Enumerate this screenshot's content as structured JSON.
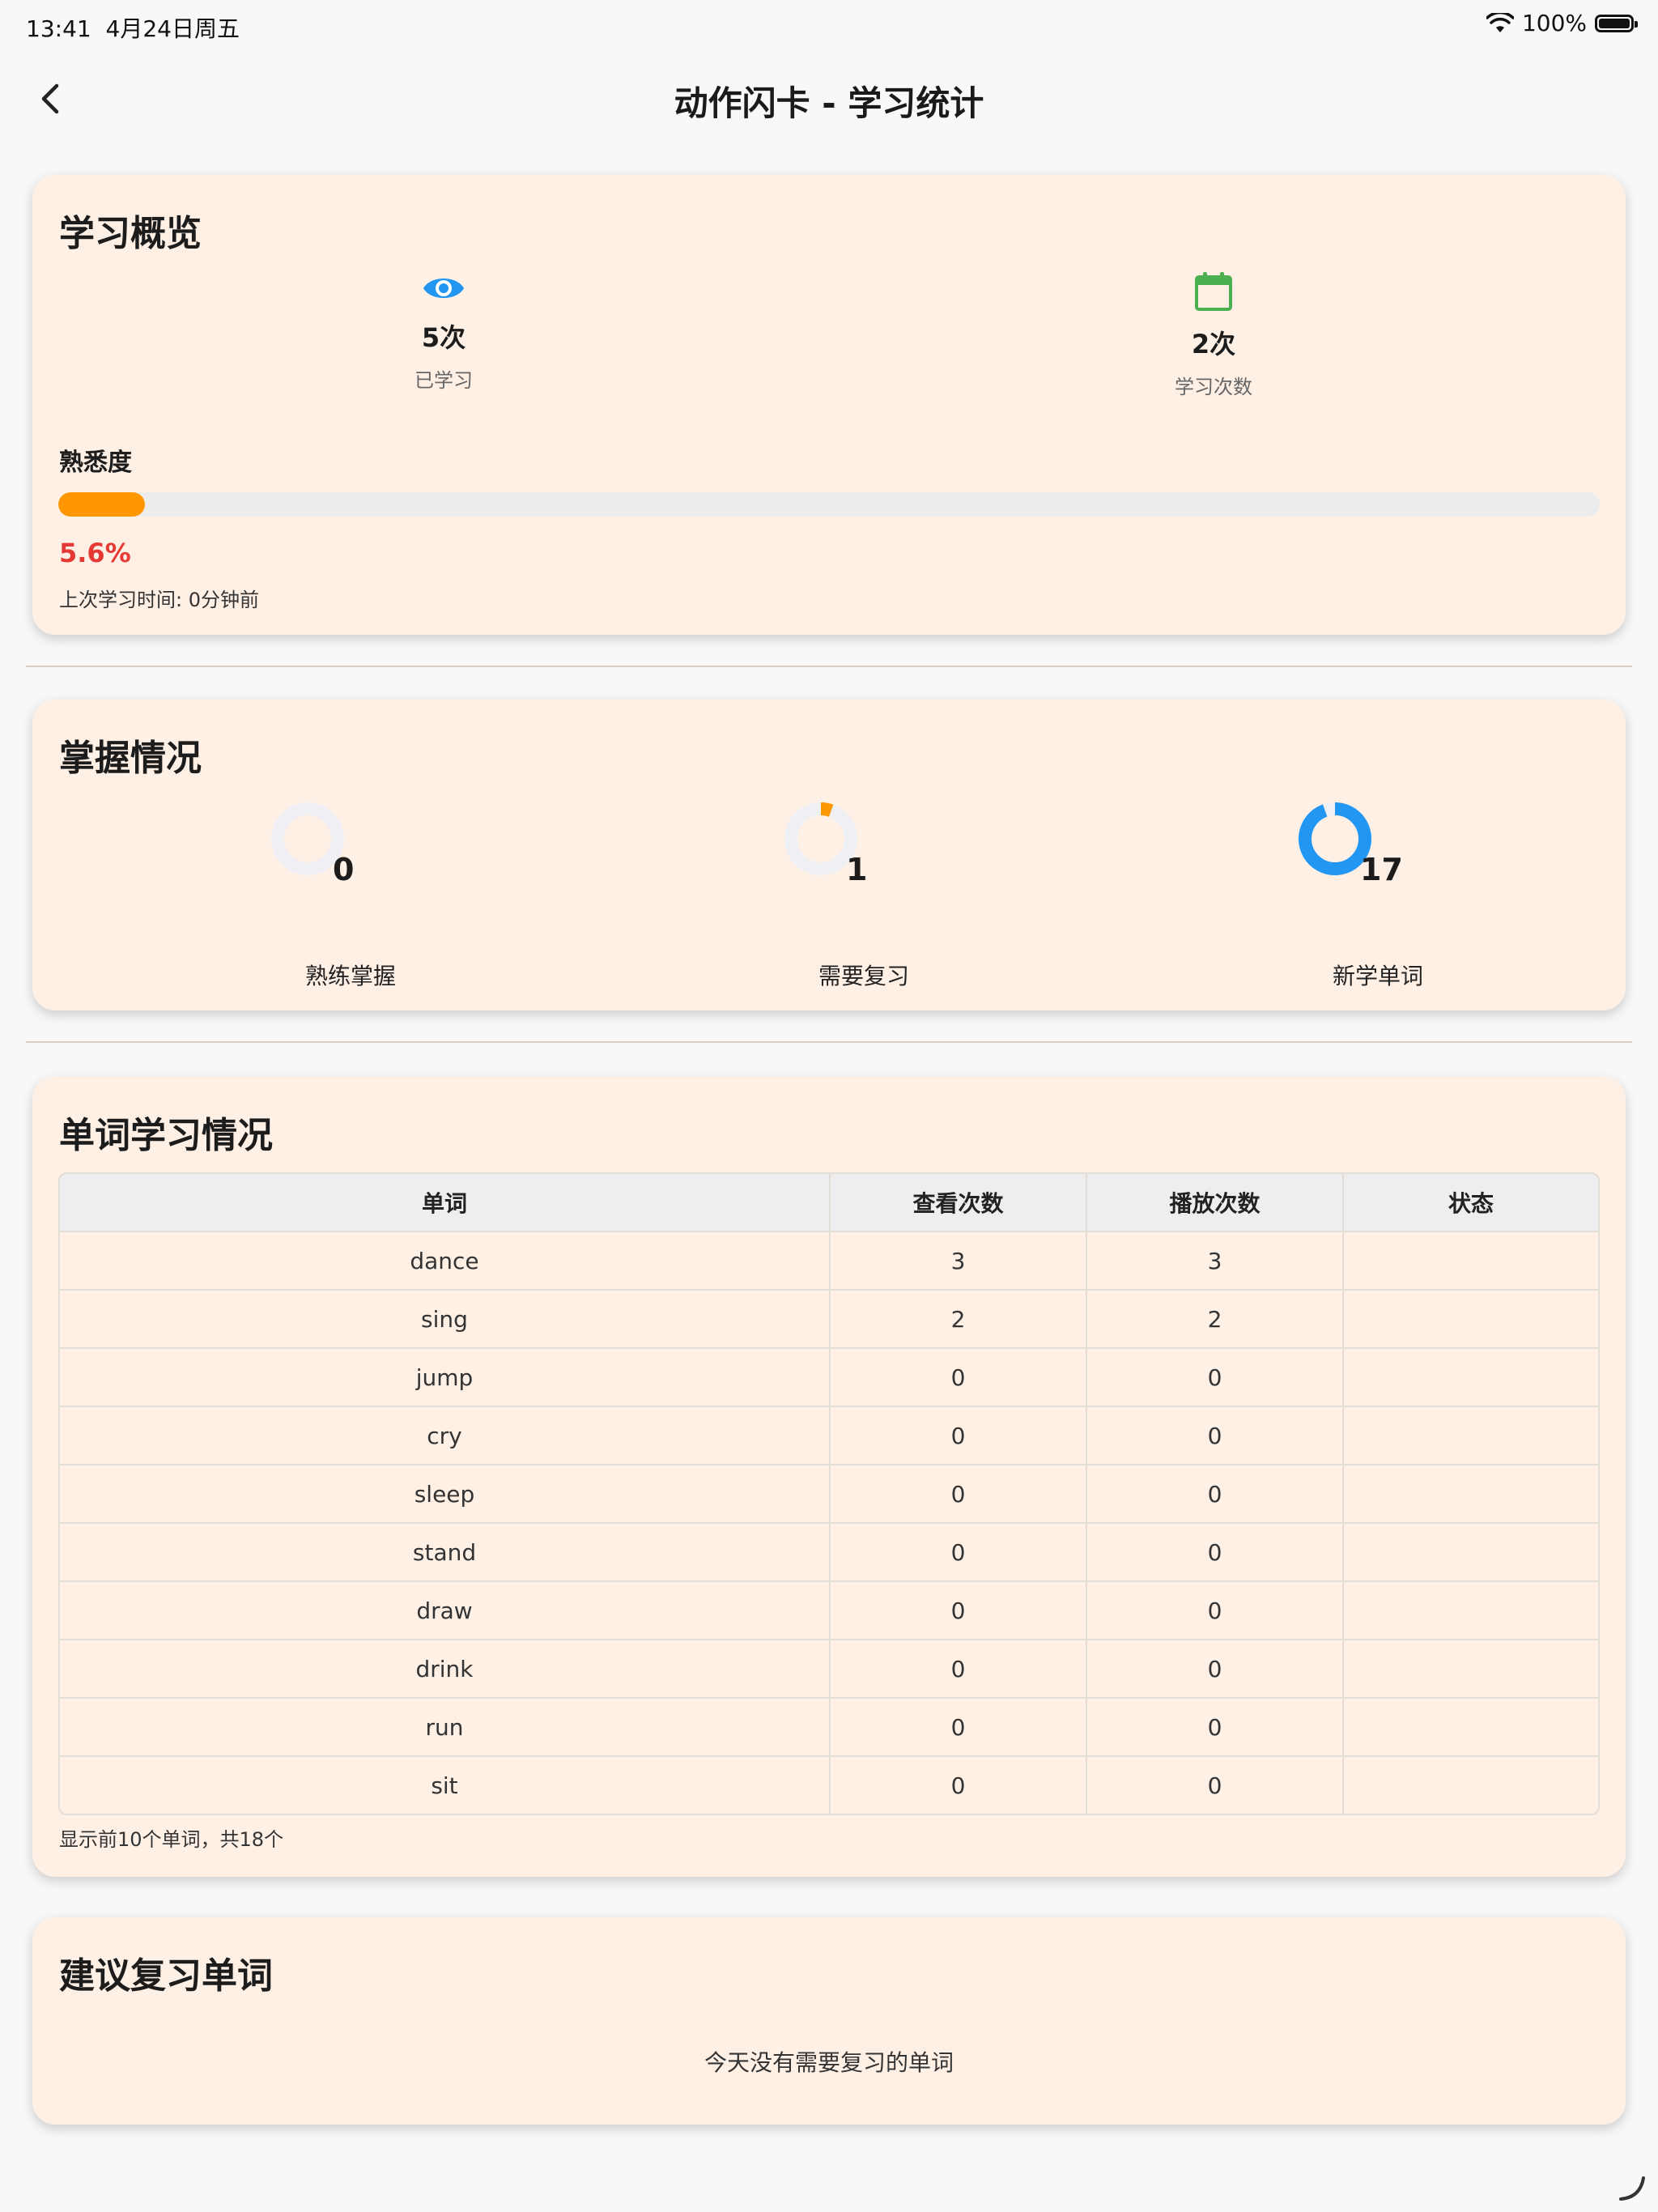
{
  "status_bar": {
    "time": "13:41",
    "date": "4月24日周五",
    "battery": "100%"
  },
  "nav": {
    "title": "动作闪卡 - 学习统计"
  },
  "overview": {
    "title": "学习概览",
    "stats": [
      {
        "icon": "eye-icon",
        "value": "5次",
        "label": "已学习",
        "color": "#2196f3"
      },
      {
        "icon": "calendar-icon",
        "value": "2次",
        "label": "学习次数",
        "color": "#4caf50"
      }
    ],
    "familiarity_label": "熟悉度",
    "familiarity_percent": "5.6%",
    "familiarity_fraction": 0.056,
    "progress_color": "#ff9800",
    "last_study": "上次学习时间: 0分钟前"
  },
  "mastery": {
    "title": "掌握情况",
    "items": [
      {
        "value": "0",
        "label": "熟练掌握",
        "fraction": 0.0,
        "color": "#4caf50"
      },
      {
        "value": "1",
        "label": "需要复习",
        "fraction": 0.0556,
        "color": "#ff9800"
      },
      {
        "value": "17",
        "label": "新学单词",
        "fraction": 0.9444,
        "color": "#2196f3"
      }
    ]
  },
  "words": {
    "title": "单词学习情况",
    "headers": [
      "单词",
      "查看次数",
      "播放次数",
      "状态"
    ],
    "rows": [
      [
        "dance",
        "3",
        "3",
        ""
      ],
      [
        "sing",
        "2",
        "2",
        ""
      ],
      [
        "jump",
        "0",
        "0",
        ""
      ],
      [
        "cry",
        "0",
        "0",
        ""
      ],
      [
        "sleep",
        "0",
        "0",
        ""
      ],
      [
        "stand",
        "0",
        "0",
        ""
      ],
      [
        "draw",
        "0",
        "0",
        ""
      ],
      [
        "drink",
        "0",
        "0",
        ""
      ],
      [
        "run",
        "0",
        "0",
        ""
      ],
      [
        "sit",
        "0",
        "0",
        ""
      ]
    ],
    "note": "显示前10个单词，共18个"
  },
  "review": {
    "title": "建议复习单词",
    "empty_message": "今天没有需要复习的单词"
  }
}
